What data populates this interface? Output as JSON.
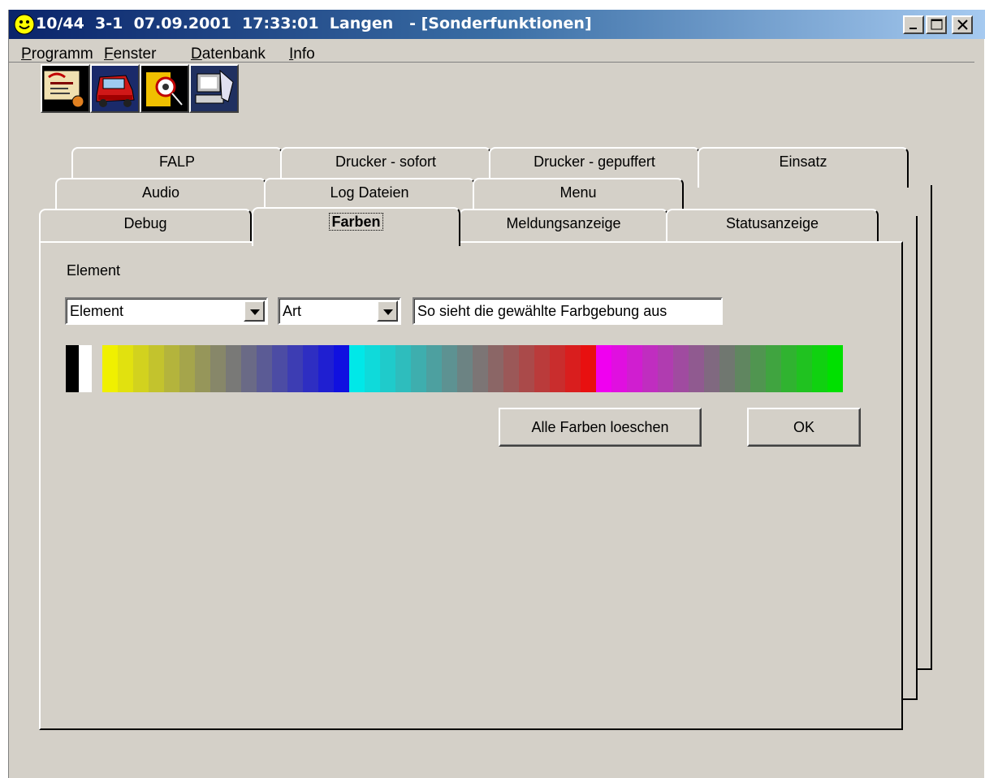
{
  "window": {
    "title": "10/44  3-1  07.09.2001  17:33:01  Langen   - [Sonderfunktionen]",
    "controls": [
      "minimize",
      "maximize",
      "close"
    ]
  },
  "menubar": {
    "items": [
      {
        "label": "Programm",
        "accel": "P"
      },
      {
        "label": "Fenster",
        "accel": "F"
      },
      {
        "label": "Datenbank",
        "accel": "D"
      },
      {
        "label": "Info",
        "accel": "I"
      }
    ]
  },
  "toolbar": {
    "icons": [
      "document-icon",
      "car-icon",
      "magnifier-person-icon",
      "computer-icon"
    ]
  },
  "tabs": {
    "row1": [
      "FALP",
      "Drucker - sofort",
      "Drucker - gepuffert",
      "Einsatz"
    ],
    "row2": [
      "Audio",
      "Log Dateien",
      "Menu"
    ],
    "row3": [
      "Debug",
      "Farben",
      "Meldungsanzeige",
      "Statusanzeige"
    ],
    "active": "Farben"
  },
  "farben": {
    "element_label": "Element",
    "element_combo": "Element",
    "art_combo": "Art",
    "preview_text": "So sieht die gewählte Farbgebung aus",
    "clear_button": "Alle Farben loeschen",
    "ok_button": "OK",
    "palette_colors": {
      "bw": [
        "#000000",
        "#ffffff"
      ],
      "gradients": [
        {
          "from": "#f0f000",
          "to": "#1010e0"
        },
        {
          "from": "#00e8e8",
          "to": "#e81010"
        },
        {
          "from": "#f000f0",
          "to": "#00e000"
        }
      ]
    }
  }
}
